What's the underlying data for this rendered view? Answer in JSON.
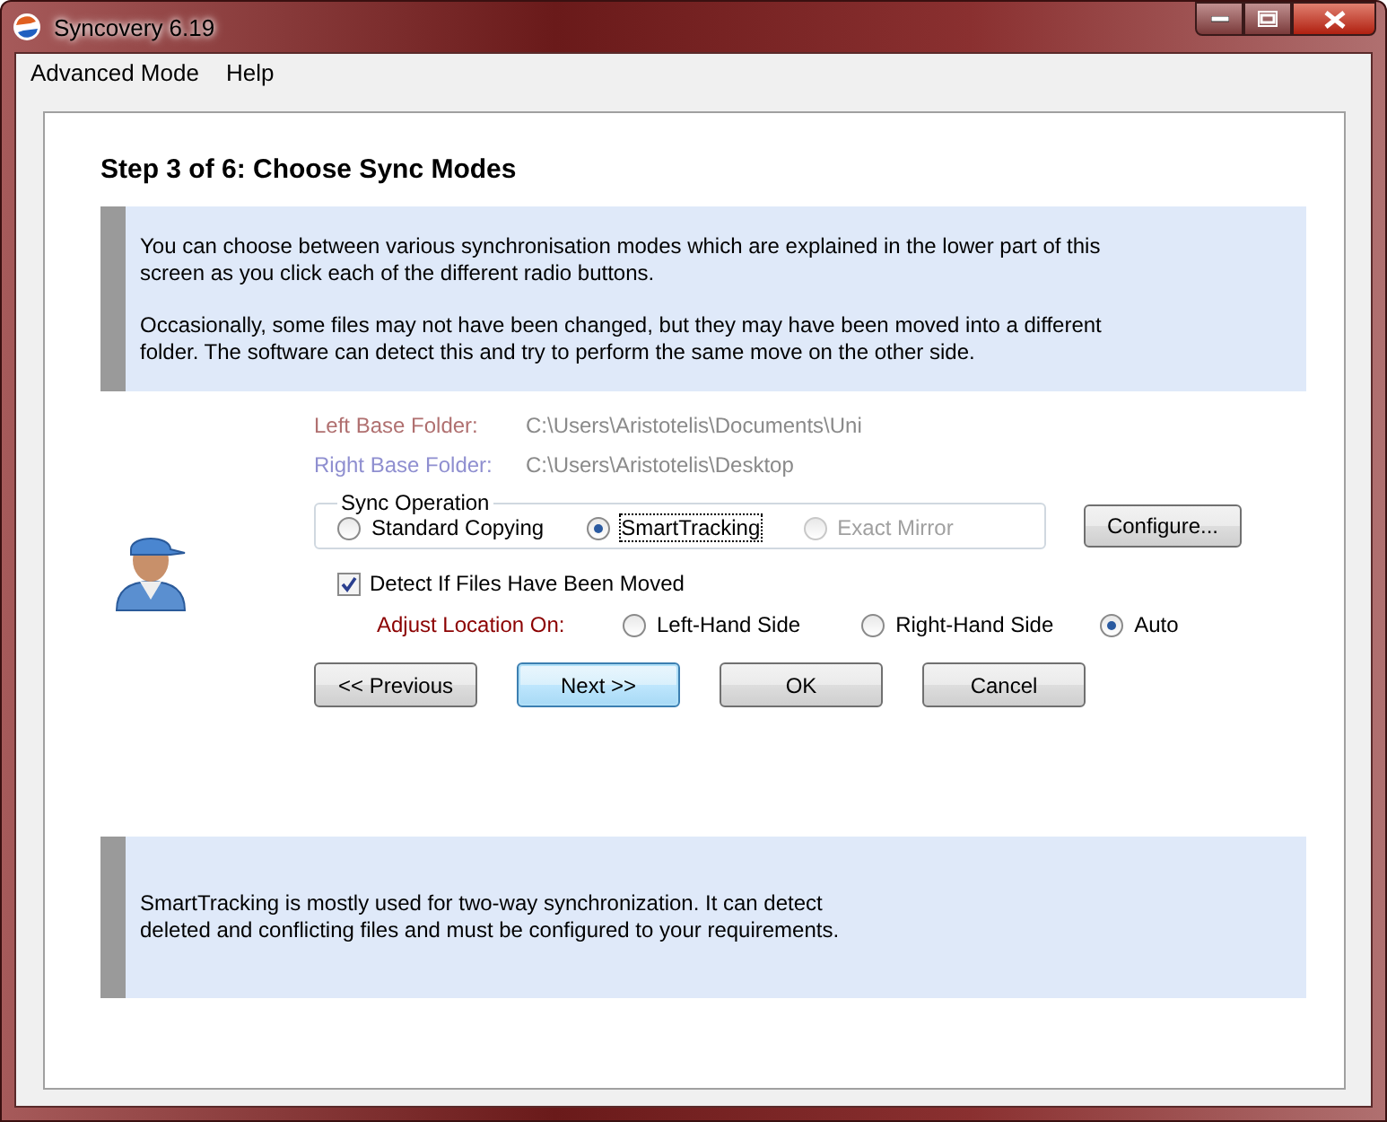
{
  "window": {
    "title": "Syncovery 6.19"
  },
  "menu": [
    "Advanced Mode",
    "Help"
  ],
  "step_title": "Step 3 of 6: Choose Sync Modes",
  "intro": [
    "You can choose between various synchronisation modes which are explained in the lower part of this screen as you click each of the different radio buttons.",
    "Occasionally, some files may not have been changed, but they may have been moved into a different folder. The software can detect this and try to perform the same move on the other side."
  ],
  "folders": [
    {
      "label": "Left Base Folder:",
      "value": "C:\\Users\\Aristotelis\\Documents\\Uni",
      "color": "#b07070"
    },
    {
      "label": "Right Base Folder:",
      "value": "C:\\Users\\Aristotelis\\Desktop",
      "color": "#8f8fd0"
    }
  ],
  "sync_operation": {
    "label": "Sync Operation",
    "options": [
      {
        "label": "Standard Copying",
        "selected": false,
        "disabled": false
      },
      {
        "label": "SmartTracking",
        "selected": true,
        "disabled": false
      },
      {
        "label": "Exact Mirror",
        "selected": false,
        "disabled": true
      }
    ]
  },
  "configure_button": "Configure...",
  "detect_moved": {
    "label": "Detect If Files Have Been Moved",
    "checked": true
  },
  "adjust_location": {
    "label": "Adjust Location On:",
    "options": [
      {
        "label": "Left-Hand Side",
        "selected": false
      },
      {
        "label": "Right-Hand Side",
        "selected": false
      },
      {
        "label": "Auto",
        "selected": true
      }
    ]
  },
  "buttons": [
    {
      "label": "<< Previous",
      "default": false
    },
    {
      "label": "Next >>",
      "default": true
    },
    {
      "label": "OK",
      "default": false
    },
    {
      "label": "Cancel",
      "default": false
    }
  ],
  "description": "SmartTracking is mostly used for two-way synchronization. It can detect deleted and conflicting files and must be configured to your requirements."
}
